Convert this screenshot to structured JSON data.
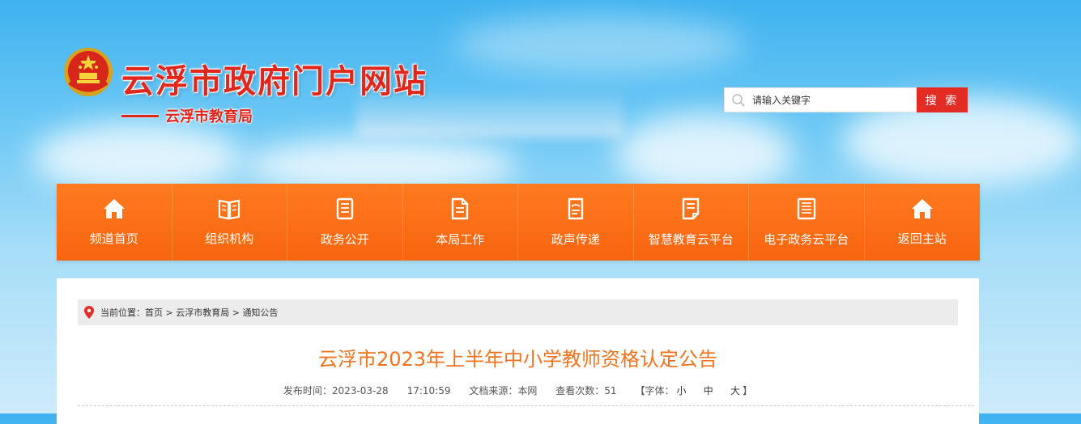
{
  "header": {
    "site_title": "云浮市政府门户网站",
    "sub_title": "云浮市教育局"
  },
  "search": {
    "placeholder": "请输入关键字",
    "button_label": "搜 索"
  },
  "nav": {
    "items": [
      {
        "label": "频道首页",
        "icon": "home-icon"
      },
      {
        "label": "组织机构",
        "icon": "book-icon"
      },
      {
        "label": "政务公开",
        "icon": "document-icon"
      },
      {
        "label": "本局工作",
        "icon": "file-icon"
      },
      {
        "label": "政声传递",
        "icon": "notes-icon"
      },
      {
        "label": "智慧教育云平台",
        "icon": "clipboard-icon"
      },
      {
        "label": "电子政务云平台",
        "icon": "list-doc-icon"
      },
      {
        "label": "返回主站",
        "icon": "home-icon"
      }
    ]
  },
  "breadcrumb": {
    "prefix": "当前位置：",
    "items": [
      "首页",
      "云浮市教育局",
      "通知公告"
    ],
    "separator": ">"
  },
  "article": {
    "title": "云浮市2023年上半年中小学教师资格认定公告",
    "publish_label": "发布时间：",
    "publish_date": "2023-03-28",
    "publish_time": "17:10:59",
    "source_label": "文档来源：",
    "source": "本网",
    "views_label": "查看次数：",
    "views": "51",
    "font_label": "【字体：",
    "font_small": "小",
    "font_medium": "中",
    "font_large": "大",
    "font_close": "】"
  },
  "colors": {
    "brand_red": "#e1261c",
    "nav_orange": "#f8650e",
    "title_orange": "#f07320"
  }
}
